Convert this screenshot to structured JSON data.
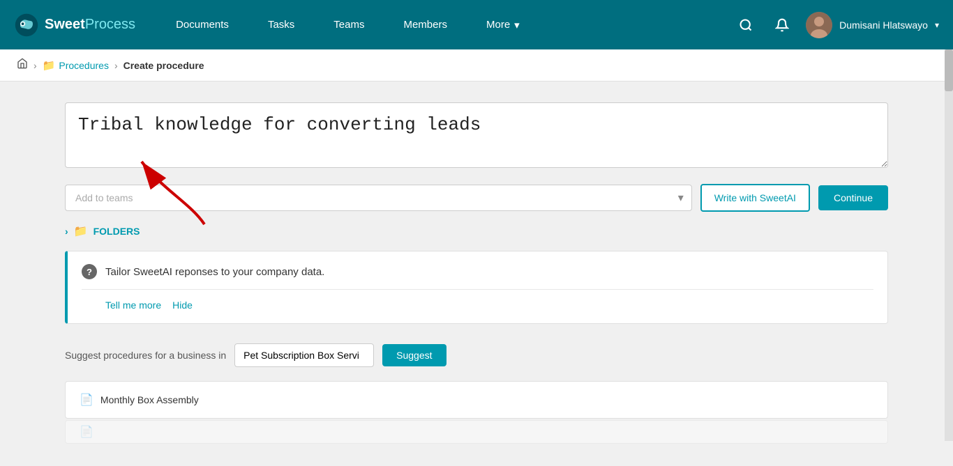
{
  "brand": {
    "name_bold": "Sweet",
    "name_light": "Process"
  },
  "navbar": {
    "links": [
      {
        "id": "documents",
        "label": "Documents"
      },
      {
        "id": "tasks",
        "label": "Tasks"
      },
      {
        "id": "teams",
        "label": "Teams"
      },
      {
        "id": "members",
        "label": "Members"
      },
      {
        "id": "more",
        "label": "More"
      }
    ],
    "user_name": "Dumisani Hlatswayo"
  },
  "breadcrumb": {
    "home_label": "🏠",
    "procedures_label": "Procedures",
    "current_label": "Create procedure"
  },
  "form": {
    "title_value": "Tribal knowledge for converting leads",
    "teams_placeholder": "Add to teams",
    "btn_write_sweetai": "Write with SweetAI",
    "btn_continue": "Continue"
  },
  "folders": {
    "label": "FOLDERS"
  },
  "sweetai_banner": {
    "text": "Tailor SweetAI reponses to your company data.",
    "link_tell_more": "Tell me more",
    "link_hide": "Hide"
  },
  "suggest": {
    "label": "Suggest procedures for a business in",
    "input_value": "Pet Subscription Box Servi",
    "btn_label": "Suggest"
  },
  "procedures": [
    {
      "id": "p1",
      "label": "Monthly Box Assembly"
    },
    {
      "id": "p2",
      "label": ""
    }
  ]
}
